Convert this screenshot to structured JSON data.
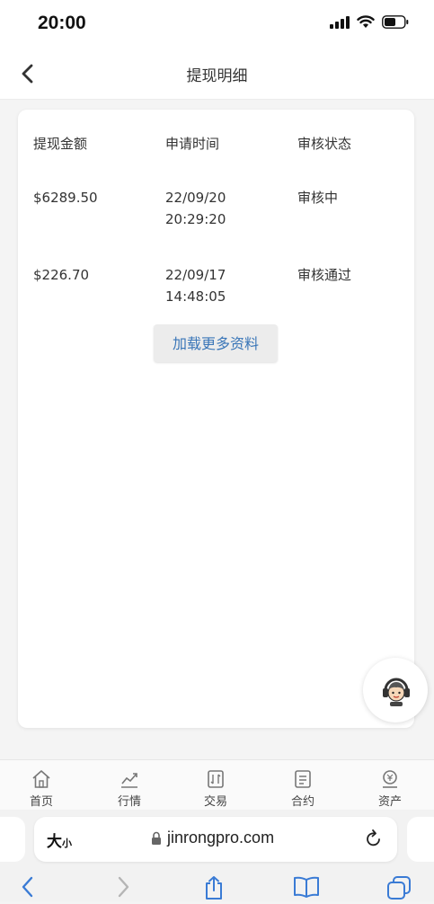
{
  "status_bar": {
    "time": "20:00"
  },
  "nav": {
    "title": "提现明细"
  },
  "table": {
    "headers": [
      "提现金额",
      "申请时间",
      "审核状态"
    ],
    "rows": [
      {
        "amount": "$6289.50",
        "date": "22/09/20",
        "time": "20:29:20",
        "status": "审核中"
      },
      {
        "amount": "$226.70",
        "date": "22/09/17",
        "time": "14:48:05",
        "status": "审核通过"
      }
    ]
  },
  "load_more": "加载更多资料",
  "tab_bar": {
    "items": [
      {
        "label": "首页",
        "icon": "home-icon"
      },
      {
        "label": "行情",
        "icon": "chart-icon"
      },
      {
        "label": "交易",
        "icon": "trade-icon"
      },
      {
        "label": "合约",
        "icon": "contract-icon"
      },
      {
        "label": "资产",
        "icon": "assets-icon"
      }
    ]
  },
  "browser": {
    "size_label_big": "大",
    "size_label_small": "小",
    "url": "jinrongpro.com"
  }
}
